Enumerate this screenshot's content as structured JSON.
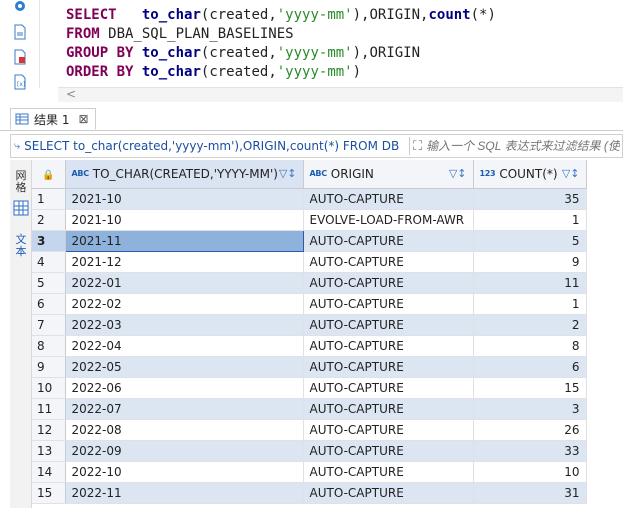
{
  "editor": {
    "lines": [
      [
        {
          "t": "SELECT",
          "c": "kw"
        },
        {
          "t": "   ",
          "c": "plain"
        },
        {
          "t": "to_char",
          "c": "fn"
        },
        {
          "t": "(created,",
          "c": "plain"
        },
        {
          "t": "'yyyy-mm'",
          "c": "str"
        },
        {
          "t": "),ORIGIN,",
          "c": "plain"
        },
        {
          "t": "count",
          "c": "fn"
        },
        {
          "t": "(*)",
          "c": "plain"
        }
      ],
      [
        {
          "t": "FROM",
          "c": "kw"
        },
        {
          "t": " DBA_SQL_PLAN_BASELINES",
          "c": "plain"
        }
      ],
      [
        {
          "t": "GROUP BY",
          "c": "kw"
        },
        {
          "t": " ",
          "c": "plain"
        },
        {
          "t": "to_char",
          "c": "fn"
        },
        {
          "t": "(created,",
          "c": "plain"
        },
        {
          "t": "'yyyy-mm'",
          "c": "str"
        },
        {
          "t": "),ORIGIN",
          "c": "plain"
        }
      ],
      [
        {
          "t": "ORDER BY",
          "c": "kw"
        },
        {
          "t": " ",
          "c": "plain"
        },
        {
          "t": "to_char",
          "c": "fn"
        },
        {
          "t": "(created,",
          "c": "plain"
        },
        {
          "t": "'yyyy-mm'",
          "c": "str"
        },
        {
          "t": ")",
          "c": "plain"
        }
      ]
    ],
    "scroll_arrow": "<"
  },
  "results_tab": {
    "label": "结果 1",
    "close": "⊠"
  },
  "filter": {
    "sql_text": "SELECT to_char(created,'yyyy-mm'),ORIGIN,count(*) FROM DB",
    "placeholder": "输入一个 SQL 表达式来过滤结果 (使用"
  },
  "side_panel": {
    "grid_label": "网格",
    "text_label": "文本"
  },
  "grid": {
    "columns": [
      {
        "type_badge": "ABC",
        "label": "TO_CHAR(CREATED,'YYYY-MM')",
        "icons": "▽↕"
      },
      {
        "type_badge": "ABC",
        "label": "ORIGIN",
        "icons": "▽↕"
      },
      {
        "type_badge": "123",
        "label": "COUNT(*)",
        "icons": "▽↕"
      }
    ],
    "selected_row": 3,
    "rows": [
      {
        "num": "1",
        "month": "2021-10",
        "origin": "AUTO-CAPTURE",
        "count": "35"
      },
      {
        "num": "2",
        "month": "2021-10",
        "origin": "EVOLVE-LOAD-FROM-AWR",
        "count": "1"
      },
      {
        "num": "3",
        "month": "2021-11",
        "origin": "AUTO-CAPTURE",
        "count": "5"
      },
      {
        "num": "4",
        "month": "2021-12",
        "origin": "AUTO-CAPTURE",
        "count": "9"
      },
      {
        "num": "5",
        "month": "2022-01",
        "origin": "AUTO-CAPTURE",
        "count": "11"
      },
      {
        "num": "6",
        "month": "2022-02",
        "origin": "AUTO-CAPTURE",
        "count": "1"
      },
      {
        "num": "7",
        "month": "2022-03",
        "origin": "AUTO-CAPTURE",
        "count": "2"
      },
      {
        "num": "8",
        "month": "2022-04",
        "origin": "AUTO-CAPTURE",
        "count": "8"
      },
      {
        "num": "9",
        "month": "2022-05",
        "origin": "AUTO-CAPTURE",
        "count": "6"
      },
      {
        "num": "10",
        "month": "2022-06",
        "origin": "AUTO-CAPTURE",
        "count": "15"
      },
      {
        "num": "11",
        "month": "2022-07",
        "origin": "AUTO-CAPTURE",
        "count": "3"
      },
      {
        "num": "12",
        "month": "2022-08",
        "origin": "AUTO-CAPTURE",
        "count": "26"
      },
      {
        "num": "13",
        "month": "2022-09",
        "origin": "AUTO-CAPTURE",
        "count": "33"
      },
      {
        "num": "14",
        "month": "2022-10",
        "origin": "AUTO-CAPTURE",
        "count": "10"
      },
      {
        "num": "15",
        "month": "2022-11",
        "origin": "AUTO-CAPTURE",
        "count": "31"
      }
    ]
  },
  "colors": {
    "keyword": "#7f0055",
    "function": "#000080",
    "string": "#2a8a2a",
    "row_stripe": "#dce6f3",
    "selection": "#8fb2dd"
  }
}
